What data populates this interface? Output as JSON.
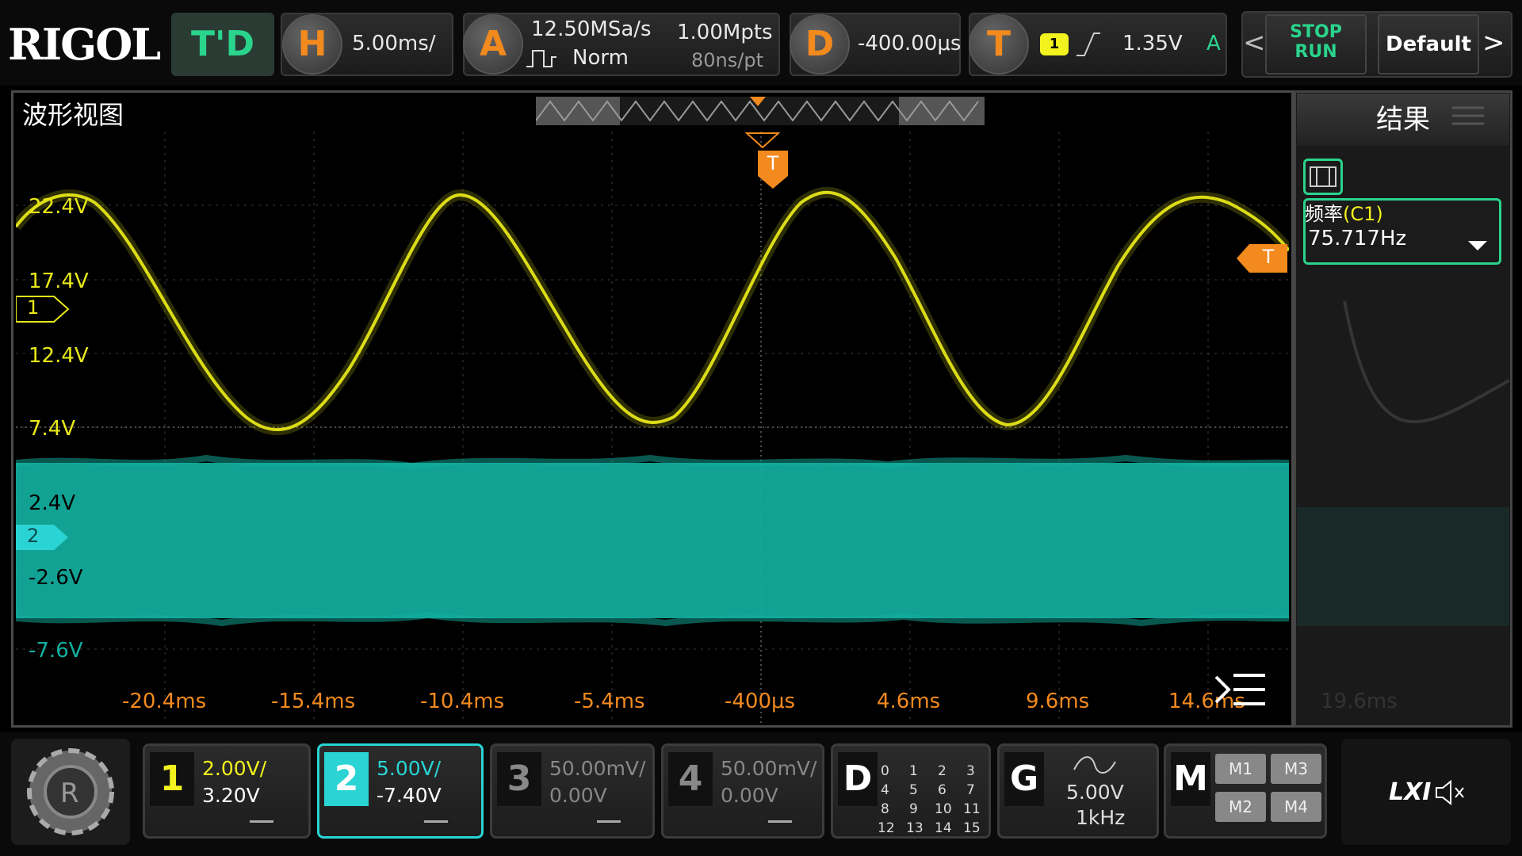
{
  "topbar": {
    "brand": "RIGOL",
    "mode": "T'D",
    "horizontal": {
      "key": "H",
      "value": "5.00ms/"
    },
    "acquire": {
      "key": "A",
      "rate": "12.50MSa/s",
      "depth": "1.00Mpts",
      "mode": "Norm",
      "resolution": "80ns/pt"
    },
    "delay": {
      "key": "D",
      "value": "-400.00μs"
    },
    "trigger": {
      "key": "T",
      "source": "1",
      "level": "1.35V",
      "sweep": "A"
    },
    "stop_label": "STOP",
    "run_label": "RUN",
    "default_label": "Default"
  },
  "waveform": {
    "title": "波形视图",
    "trigger_marker": "T",
    "ch1_marker": "1",
    "ch2_marker": "2",
    "y_labels": [
      "22.4V",
      "17.4V",
      "12.4V",
      "7.4V",
      "2.4V",
      "-2.6V",
      "-7.6V"
    ],
    "x_labels": [
      "-20.4ms",
      "-15.4ms",
      "-10.4ms",
      "-5.4ms",
      "-400μs",
      "4.6ms",
      "9.6ms",
      "14.6ms"
    ],
    "ghost_x_label": "19.6ms"
  },
  "results": {
    "title": "结果",
    "measurement": {
      "name": "频率",
      "source": "(C1)",
      "value": "75.717Hz"
    }
  },
  "bottom": {
    "ch1": {
      "num": "1",
      "scale": "2.00V/",
      "offset": "3.20V"
    },
    "ch2": {
      "num": "2",
      "scale": "5.00V/",
      "offset": "-7.40V"
    },
    "ch3": {
      "num": "3",
      "scale": "50.00mV/",
      "offset": "0.00V"
    },
    "ch4": {
      "num": "4",
      "scale": "50.00mV/",
      "offset": "0.00V"
    },
    "digital": {
      "key": "D",
      "channels": [
        "0",
        "1",
        "2",
        "3",
        "4",
        "5",
        "6",
        "7",
        "8",
        "9",
        "10",
        "11",
        "12",
        "13",
        "14",
        "15"
      ]
    },
    "generator": {
      "key": "G",
      "amplitude": "5.00V",
      "frequency": "1kHz"
    },
    "math": {
      "key": "M",
      "items": [
        "M1",
        "M3",
        "M2",
        "M4"
      ]
    },
    "lxi": "LXI"
  },
  "colors": {
    "ch1": "#f2f21e",
    "ch2": "#12b0a0",
    "accent": "#f28a1e",
    "green": "#2ad48c"
  }
}
